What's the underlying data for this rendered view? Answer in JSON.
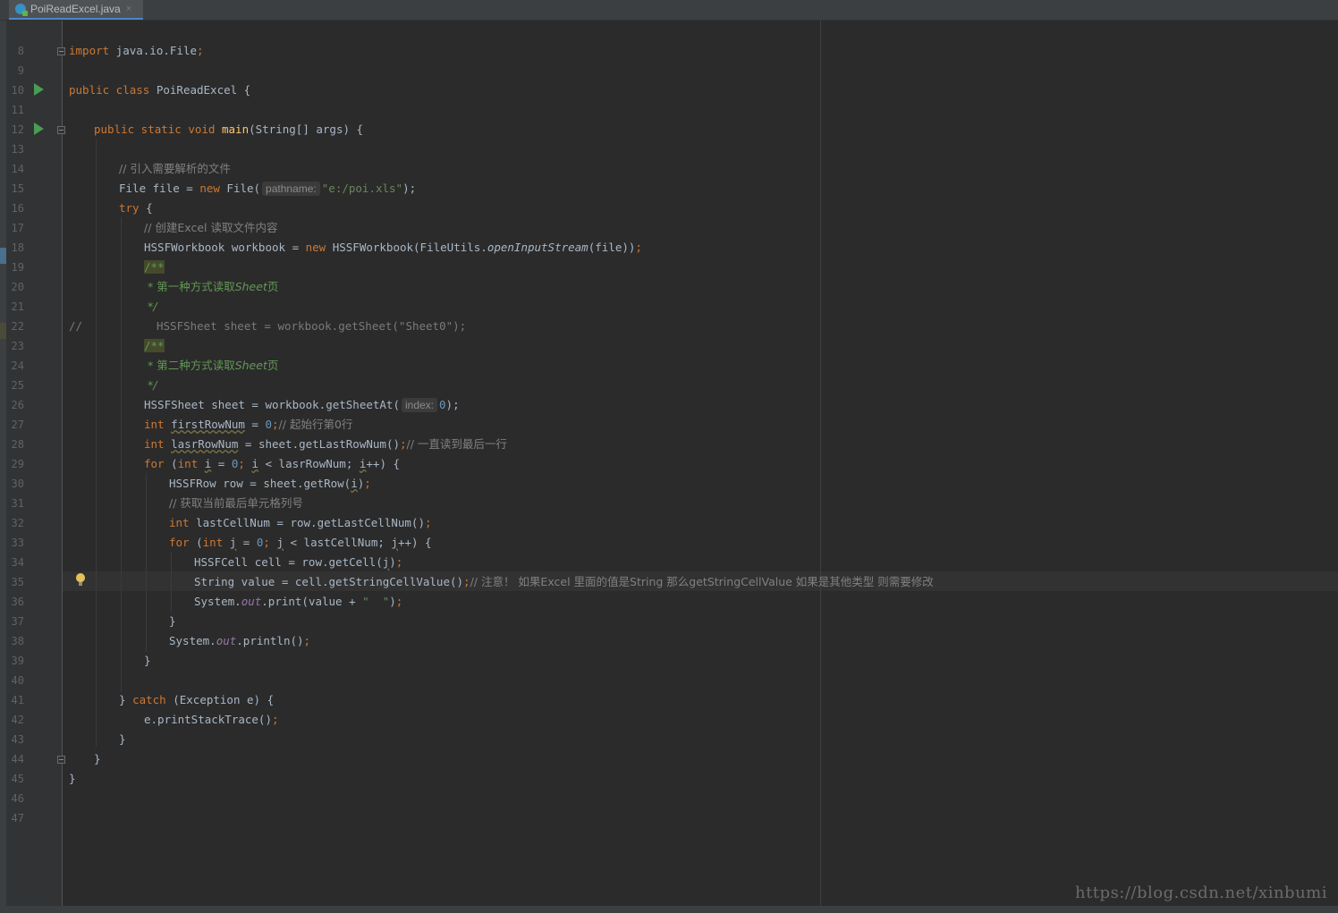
{
  "tab": {
    "filename": "PoiReadExcel.java",
    "close": "×"
  },
  "lines": [
    {
      "n": "8"
    },
    {
      "n": "9",
      "t": [
        "import",
        " java.io.File",
        ";"
      ]
    },
    {
      "n": "10"
    },
    {
      "n": "11",
      "t": [
        "public class",
        " PoiReadExcel {"
      ]
    },
    {
      "n": "12"
    },
    {
      "n": "13",
      "t": [
        "public static void",
        " ",
        "main",
        "(String[] args) {"
      ]
    },
    {
      "n": "14"
    },
    {
      "n": "15",
      "t": [
        "// 引入需要解析的文件"
      ]
    },
    {
      "n": "16",
      "t": [
        "File file = ",
        "new",
        " File(",
        "pathname:",
        "\"e:/poi.xls\"",
        ");"
      ]
    },
    {
      "n": "17",
      "t": [
        "try",
        " {"
      ]
    },
    {
      "n": "18",
      "t": [
        "// 创建Excel 读取文件内容"
      ]
    },
    {
      "n": "19",
      "t": [
        "HSSFWorkbook workbook = ",
        "new",
        " HSSFWorkbook(FileUtils.",
        "openInputStream",
        "(file))",
        ";"
      ]
    },
    {
      "n": "20",
      "t": [
        "/**"
      ]
    },
    {
      "n": "21",
      "t": [
        " * 第一种方式读取",
        "Sheet",
        "页"
      ]
    },
    {
      "n": "22",
      "t": [
        " */"
      ]
    },
    {
      "n": "23",
      "t": [
        "//",
        "HSSFSheet sheet = workbook.getSheet(\"Sheet0\");"
      ]
    },
    {
      "n": "24",
      "t": [
        "/**"
      ]
    },
    {
      "n": "25",
      "t": [
        " * 第二种方式读取",
        "Sheet",
        "页"
      ]
    },
    {
      "n": "26",
      "t": [
        " */"
      ]
    },
    {
      "n": "27",
      "t": [
        "HSSFSheet sheet = workbook.getSheetAt(",
        "index:",
        "0",
        ");"
      ]
    },
    {
      "n": "28",
      "t": [
        "int",
        " ",
        "firstRowNum",
        " = ",
        "0",
        ";",
        "// 起始行第0行"
      ]
    },
    {
      "n": "29",
      "t": [
        "int",
        " ",
        "lasrRowNum",
        " = sheet.getLastRowNum()",
        ";",
        "// 一直读到最后一行"
      ]
    },
    {
      "n": "30",
      "t": [
        "for",
        " (",
        "int",
        " ",
        "i",
        " = ",
        "0",
        "; ",
        "i",
        " < lasrRowNum; ",
        "i",
        "++) {"
      ]
    },
    {
      "n": "31",
      "t": [
        "HSSFRow row = sheet.getRow(",
        "i",
        ")",
        ";"
      ]
    },
    {
      "n": "32",
      "t": [
        "// 获取当前最后单元格列号"
      ]
    },
    {
      "n": "33",
      "t": [
        "int",
        " lastCellNum = row.getLastCellNum()",
        ";"
      ]
    },
    {
      "n": "34",
      "t": [
        "for",
        " (",
        "int",
        " ",
        "j",
        " = ",
        "0",
        "; ",
        "j",
        " < lastCellNum; ",
        "j",
        "++) {"
      ]
    },
    {
      "n": "35",
      "t": [
        "HSSFCell cell = row.getCell(",
        "j",
        ")",
        ";"
      ]
    },
    {
      "n": "36",
      "t": [
        "String value = cell.getStringCellValue()",
        ";",
        "// 注意！ 如果Excel 里面的值是String 那么getStringCellValue 如果是其他类型 则需要修改"
      ]
    },
    {
      "n": "37",
      "t": [
        "System.",
        "out",
        ".print(value + ",
        "\"  \"",
        ")",
        ";"
      ]
    },
    {
      "n": "38",
      "t": [
        "}"
      ]
    },
    {
      "n": "39",
      "t": [
        "System.",
        "out",
        ".println()",
        ";"
      ]
    },
    {
      "n": "40",
      "t": [
        "}"
      ]
    },
    {
      "n": "41"
    },
    {
      "n": "42",
      "t": [
        "} ",
        "catch",
        " (Exception e) {"
      ]
    },
    {
      "n": "43",
      "t": [
        "e.printStackTrace()",
        ";"
      ]
    },
    {
      "n": "44",
      "t": [
        "}"
      ]
    },
    {
      "n": "45",
      "t": [
        "}"
      ]
    },
    {
      "n": "46",
      "t": [
        "}"
      ]
    },
    {
      "n": "47"
    }
  ],
  "watermark": "https://blog.csdn.net/xinbumi"
}
